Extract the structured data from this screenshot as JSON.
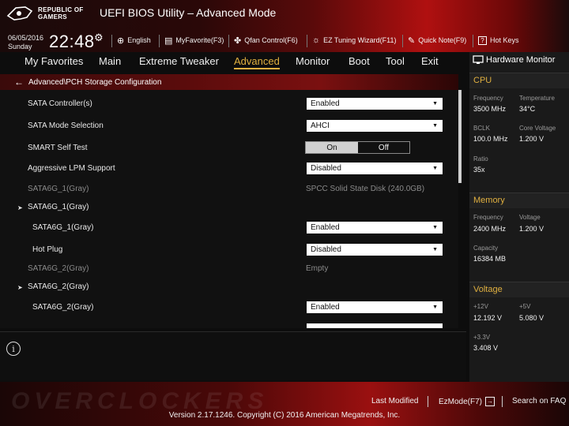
{
  "header": {
    "brand_line1": "REPUBLIC OF",
    "brand_line2": "GAMERS",
    "title": "UEFI BIOS Utility – Advanced Mode",
    "date": "06/05/2016",
    "day": "Sunday",
    "time": "22:48",
    "items": [
      {
        "icon": "globe-icon",
        "glyph": "⊕",
        "label": "English"
      },
      {
        "icon": "favorite-icon",
        "glyph": "▤",
        "label": "MyFavorite(F3)"
      },
      {
        "icon": "fan-icon",
        "glyph": "✤",
        "label": "Qfan Control(F6)"
      },
      {
        "icon": "bulb-icon",
        "glyph": "☼",
        "label": "EZ Tuning Wizard(F11)"
      },
      {
        "icon": "note-icon",
        "glyph": "✎",
        "label": "Quick Note(F9)"
      },
      {
        "icon": "help-icon",
        "glyph": "?",
        "label": "Hot Keys"
      }
    ]
  },
  "nav": {
    "tabs": [
      "My Favorites",
      "Main",
      "Extreme Tweaker",
      "Advanced",
      "Monitor",
      "Boot",
      "Tool",
      "Exit"
    ],
    "active": "Advanced"
  },
  "main": {
    "breadcrumb": "Advanced\\PCH Storage Configuration",
    "rows": {
      "sata_controller": {
        "label": "SATA Controller(s)",
        "value": "Enabled"
      },
      "sata_mode": {
        "label": "SATA Mode Selection",
        "value": "AHCI"
      },
      "smart": {
        "label": "SMART Self Test",
        "on": "On",
        "off": "Off"
      },
      "lpm": {
        "label": "Aggressive LPM Support",
        "value": "Disabled"
      },
      "port1_info": {
        "label": "SATA6G_1(Gray)",
        "value": "SPCC Solid State Disk (240.0GB)"
      },
      "port1_group": {
        "label": "SATA6G_1(Gray)"
      },
      "port1_enable": {
        "label": "SATA6G_1(Gray)",
        "value": "Enabled"
      },
      "hot_plug": {
        "label": "Hot Plug",
        "value": "Disabled"
      },
      "port2_info": {
        "label": "SATA6G_2(Gray)",
        "value": "Empty"
      },
      "port2_group": {
        "label": "SATA6G_2(Gray)"
      },
      "port2_enable": {
        "label": "SATA6G_2(Gray)",
        "value": "Enabled"
      }
    }
  },
  "hw": {
    "title": "Hardware Monitor",
    "cpu": {
      "title": "CPU",
      "frequency_label": "Frequency",
      "frequency": "3500 MHz",
      "temperature_label": "Temperature",
      "temperature": "34°C",
      "bclk_label": "BCLK",
      "bclk": "100.0 MHz",
      "core_voltage_label": "Core Voltage",
      "core_voltage": "1.200 V",
      "ratio_label": "Ratio",
      "ratio": "35x"
    },
    "memory": {
      "title": "Memory",
      "frequency_label": "Frequency",
      "frequency": "2400 MHz",
      "voltage_label": "Voltage",
      "voltage": "1.200 V",
      "capacity_label": "Capacity",
      "capacity": "16384 MB"
    },
    "voltage": {
      "title": "Voltage",
      "v12_label": "+12V",
      "v12": "12.192 V",
      "v5_label": "+5V",
      "v5": "5.080 V",
      "v33_label": "+3.3V",
      "v33": "3.408 V"
    }
  },
  "footer": {
    "last_modified": "Last Modified",
    "ezmode": "EzMode(F7)",
    "search": "Search on FAQ",
    "version": "Version 2.17.1246. Copyright (C) 2016 American Megatrends, Inc.",
    "watermark": "OVERCLOCKERS"
  }
}
